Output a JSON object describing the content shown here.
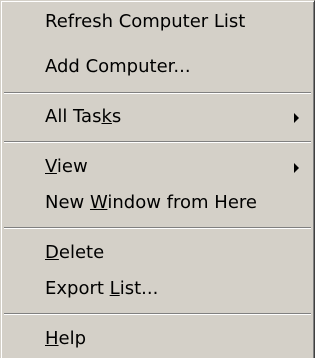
{
  "menu": {
    "items": [
      {
        "id": "refresh",
        "pre": "Refresh Computer List",
        "ul": "",
        "post": "",
        "submenu": false
      },
      {
        "id": "add",
        "pre": "Add Computer...",
        "ul": "",
        "post": "",
        "submenu": false
      },
      {
        "id": "all-tasks",
        "pre": "All Tas",
        "ul": "k",
        "post": "s",
        "submenu": true
      },
      {
        "id": "view",
        "pre": "",
        "ul": "V",
        "post": "iew",
        "submenu": true
      },
      {
        "id": "new-window",
        "pre": "New ",
        "ul": "W",
        "post": "indow from Here",
        "submenu": false
      },
      {
        "id": "delete",
        "pre": "",
        "ul": "D",
        "post": "elete",
        "submenu": false
      },
      {
        "id": "export",
        "pre": "Export ",
        "ul": "L",
        "post": "ist...",
        "submenu": false
      },
      {
        "id": "help",
        "pre": "",
        "ul": "H",
        "post": "elp",
        "submenu": false
      }
    ]
  }
}
